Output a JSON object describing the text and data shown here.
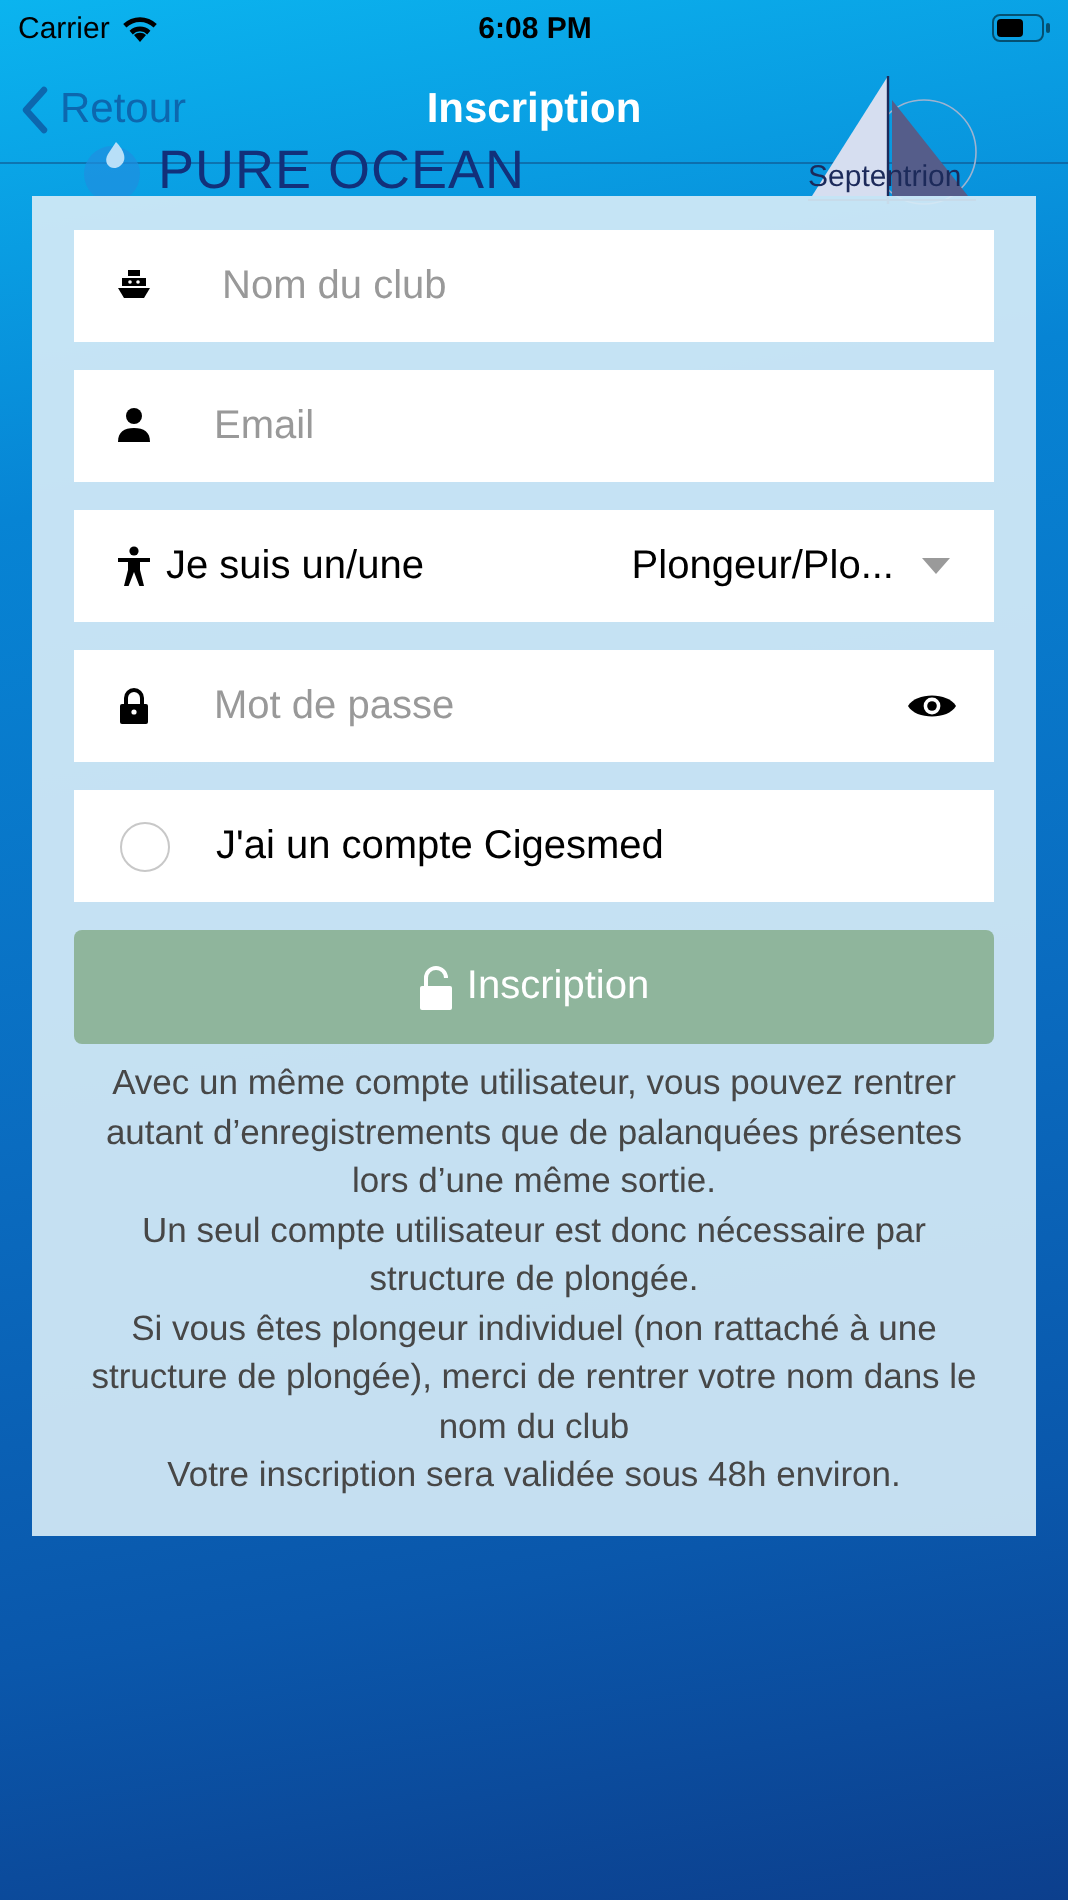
{
  "status_bar": {
    "carrier": "Carrier",
    "time": "6:08 PM"
  },
  "nav": {
    "back": "Retour",
    "title": "Inscription"
  },
  "logos": {
    "left": "PURE OCEAN",
    "right": "Septentrion"
  },
  "form": {
    "fields": [
      {
        "kind": "text",
        "placeholder": "Nom du club"
      },
      {
        "kind": "text",
        "placeholder": "Email"
      },
      {
        "kind": "select",
        "label": "Je suis un/une",
        "value": "Plongeur/Plo..."
      },
      {
        "kind": "password",
        "placeholder": "Mot de passe"
      },
      {
        "kind": "radio",
        "label": "J'ai un compte Cigesmed",
        "checked": false
      }
    ],
    "submit": {
      "label": "Inscription",
      "disabled": true
    },
    "notes": [
      "Avec un même compte utilisateur, vous pouvez rentrer autant d’enregistrements que de palanquées présentes lors d’une même sortie.",
      "Un seul compte utilisateur est donc nécessaire par structure de plongée.",
      "Si vous êtes plongeur individuel (non rattaché à une structure de plongée), merci de rentrer votre nom dans le nom du club",
      "Votre inscription sera validée sous 48h environ."
    ]
  }
}
